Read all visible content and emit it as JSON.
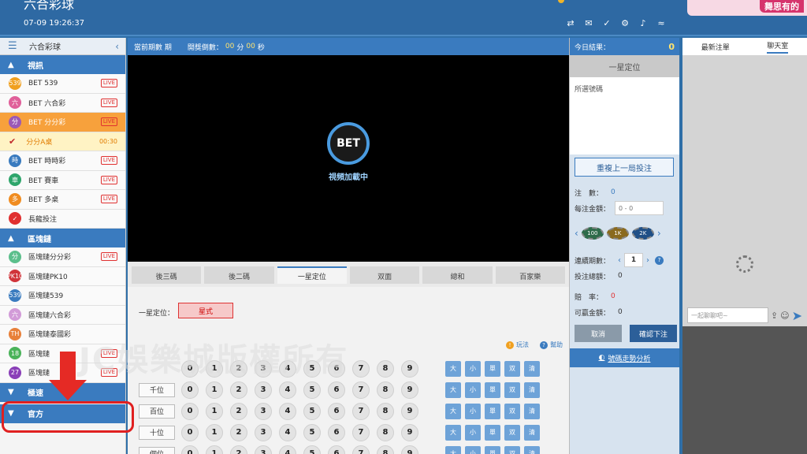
{
  "header": {
    "brand": "六合彩球",
    "nav": [
      "",
      "",
      "",
      "",
      ""
    ],
    "datetime": "07-09 19:26:37",
    "banner_tag": "舞思有的"
  },
  "sidebar": {
    "title": "六合彩球",
    "sections": {
      "video": "視訊",
      "blockchain": "區塊鏈",
      "speed": "極速",
      "official": "官方"
    },
    "video_items": [
      {
        "icon": "539",
        "label": "BET 539",
        "color": "#f0a020",
        "live": "LIVE"
      },
      {
        "icon": "六",
        "label": "BET 六合彩",
        "color": "#e0609a",
        "live": "LIVE"
      },
      {
        "icon": "分",
        "label": "BET 分分彩",
        "color": "#9b59b6",
        "live": "LIVE"
      },
      {
        "icon": "時",
        "label": "BET 時時彩",
        "color": "#3a7bbf",
        "live": "LIVE"
      },
      {
        "icon": "車",
        "label": "BET 賽車",
        "color": "#2ea56b",
        "live": "LIVE"
      },
      {
        "icon": "多",
        "label": "BET 多桌",
        "color": "#f08c20",
        "live": "LIVE"
      },
      {
        "icon": "✓",
        "label": "長龍投注",
        "color": "#e03030",
        "live": ""
      }
    ],
    "sub_item": {
      "label": "分分A桌",
      "time": "00:30"
    },
    "chain_items": [
      {
        "icon": "分",
        "label": "區塊鏈分分彩",
        "color": "#5cbf8c",
        "live": "LIVE"
      },
      {
        "icon": "PK10",
        "label": "區塊鏈PK10",
        "color": "#d0343a",
        "live": ""
      },
      {
        "icon": "539",
        "label": "區塊鏈539",
        "color": "#3a7bbf",
        "live": ""
      },
      {
        "icon": "六",
        "label": "區塊鏈六合彩",
        "color": "#d29bd8",
        "live": ""
      },
      {
        "icon": "TH",
        "label": "區塊鏈泰國彩",
        "color": "#e8803a",
        "live": ""
      },
      {
        "icon": "18",
        "label": "區塊鏈",
        "color": "#4bb35a",
        "live": "LIVE"
      },
      {
        "icon": "27",
        "label": "區塊鏈",
        "color": "#8a3fb8",
        "live": "LIVE"
      }
    ]
  },
  "center": {
    "period_label": "當前期數 期",
    "countdown_label": "開獎倒數：",
    "countdown_min": "00",
    "min_unit": "分",
    "countdown_sec": "00",
    "sec_unit": "秒",
    "video_logo": "BET",
    "video_loading": "視頻加載中",
    "tabs": [
      "後三碼",
      "後二碼",
      "一星定位",
      "双面",
      "總和",
      "百家樂"
    ],
    "position_label": "一星定位：",
    "position_button": "星式",
    "rule_text": "",
    "help_rule": "玩法",
    "help_help": "幫助",
    "rows": [
      {
        "label": ""
      },
      {
        "label": "千位"
      },
      {
        "label": "百位"
      },
      {
        "label": "十位"
      },
      {
        "label": "個位"
      }
    ],
    "balls": [
      "0",
      "1",
      "2",
      "3",
      "4",
      "5",
      "6",
      "7",
      "8",
      "9"
    ],
    "quick_opts": [
      "大",
      "小",
      "單",
      "双",
      "清"
    ]
  },
  "betpanel": {
    "today_label": "今日結果：",
    "today_value": "0",
    "mode": "一星定位",
    "picked_label": "所選號碼",
    "repeat_button": "重複上一局投注",
    "count_label": "注　數：",
    "count_value": "0",
    "amount_label": "每注金額：",
    "amount_placeholder": "0 - 0",
    "chips": [
      "100",
      "1K",
      "2K"
    ],
    "chase_label": "連續期數：",
    "chase_value": "1",
    "total_label": "投注總額：",
    "total_value": "0",
    "odds_label": "賠　率：",
    "odds_value": "0",
    "win_label": "可贏金額：",
    "win_value": "0",
    "cancel_button": "取消",
    "confirm_button": "確認下注",
    "analysis_link": "號碼走勢分析"
  },
  "chat": {
    "tab_recent": "最新注單",
    "tab_chat": "聊天室",
    "input_placeholder": "一起聊聊吧~"
  },
  "watermark": "JC娛樂城版權所有"
}
